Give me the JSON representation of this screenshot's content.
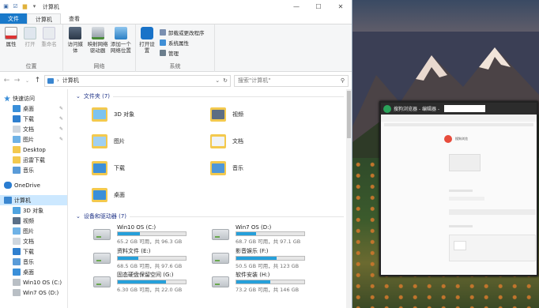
{
  "window": {
    "title": "计算机"
  },
  "tabs": [
    {
      "label": "文件"
    },
    {
      "label": "计算机"
    },
    {
      "label": "查看"
    }
  ],
  "ribbon": {
    "location": {
      "label": "位置",
      "buttons": [
        {
          "label": "属性"
        },
        {
          "label": "打开"
        },
        {
          "label": "重命名"
        }
      ]
    },
    "network": {
      "label": "网络",
      "buttons": [
        {
          "label": "访问媒体"
        },
        {
          "label": "映射网络驱动器"
        },
        {
          "label": "添加一个网络位置"
        }
      ]
    },
    "system": {
      "label": "系统",
      "open": "打开设置",
      "items": [
        {
          "label": "卸载或更改程序"
        },
        {
          "label": "系统属性"
        },
        {
          "label": "管理"
        }
      ]
    }
  },
  "address": {
    "path": "计算机",
    "search_placeholder": "搜索\"计算机\""
  },
  "sidebar": {
    "items": [
      {
        "label": "快速访问"
      },
      {
        "label": "桌面"
      },
      {
        "label": "下载"
      },
      {
        "label": "文档"
      },
      {
        "label": "图片"
      },
      {
        "label": "Desktop"
      },
      {
        "label": "迅雷下载"
      },
      {
        "label": "音乐"
      },
      {
        "label": "OneDrive"
      },
      {
        "label": "计算机"
      },
      {
        "label": "3D 对象"
      },
      {
        "label": "视频"
      },
      {
        "label": "图片"
      },
      {
        "label": "文档"
      },
      {
        "label": "下载"
      },
      {
        "label": "音乐"
      },
      {
        "label": "桌面"
      },
      {
        "label": "Win10 OS (C:)"
      },
      {
        "label": "Win7 OS (D:)"
      }
    ]
  },
  "folders_header": "文件夹 (7)",
  "folders": [
    {
      "name": "3D 对象"
    },
    {
      "name": "视频"
    },
    {
      "name": "图片"
    },
    {
      "name": "文档"
    },
    {
      "name": "下载"
    },
    {
      "name": "音乐"
    },
    {
      "name": "桌面"
    }
  ],
  "drives_header": "设备和驱动器 (7)",
  "drives": [
    {
      "name": "Win10 OS (C:)",
      "size": "65.2 GB 可用，共 96.3 GB",
      "used": 0.32
    },
    {
      "name": "Win7 OS (D:)",
      "size": "68.7 GB 可用，共 97.1 GB",
      "used": 0.29
    },
    {
      "name": "资料文件 (E:)",
      "size": "68.5 GB 可用，共 97.6 GB",
      "used": 0.3
    },
    {
      "name": "影音娱乐 (F:)",
      "size": "50.5 GB 可用，共 123 GB",
      "used": 0.59
    },
    {
      "name": "固态硬盘保留空间 (G:)",
      "size": "6.30 GB 可用，共 22.0 GB",
      "used": 0.71
    },
    {
      "name": "软件安装 (H:)",
      "size": "73.2 GB 可用，共 146 GB",
      "used": 0.5
    }
  ],
  "thumbnail": {
    "title": "搜狗浏览器 - 编辑器 -",
    "heading": "搜狗浏览"
  },
  "colors": {
    "file_tab": "#1979ca",
    "accent": "#26a0da",
    "selected": "#cce8ff"
  }
}
